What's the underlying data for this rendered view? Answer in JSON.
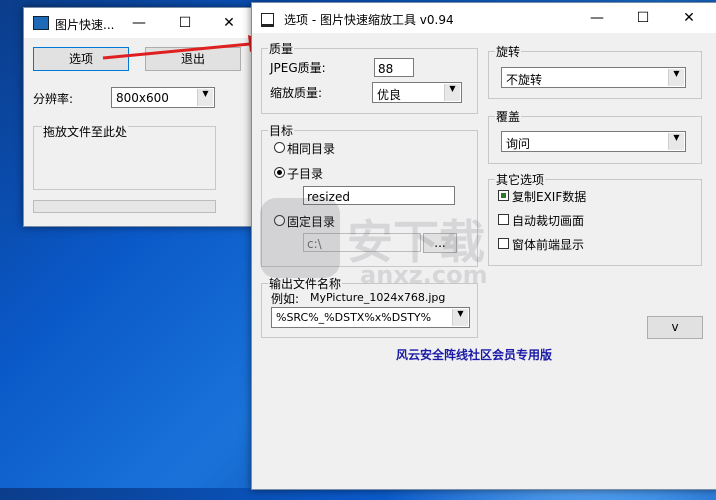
{
  "main_window": {
    "title": "图片快速...",
    "options_label": "选项",
    "exit_label": "退出",
    "resolution_label": "分辨率:",
    "resolution_value": "800x600",
    "drop_label": "拖放文件至此处"
  },
  "options_window": {
    "title": "选项 - 图片快速缩放工具 v0.94",
    "quality": {
      "group_title": "质量",
      "jpeg_label": "JPEG质量:",
      "jpeg_value": "88",
      "scale_label": "缩放质量:",
      "scale_value": "优良"
    },
    "rotate": {
      "group_title": "旋转",
      "value": "不旋转"
    },
    "overwrite": {
      "group_title": "覆盖",
      "value": "询问"
    },
    "target": {
      "group_title": "目标",
      "same_dir": "相同目录",
      "sub_dir": "子目录",
      "sub_dir_value": "resized",
      "fixed_dir": "固定目录",
      "fixed_dir_value": "c:\\",
      "browse_label": "..."
    },
    "other": {
      "group_title": "其它选项",
      "copy_exif": "复制EXIF数据",
      "auto_crop": "自动裁切画面",
      "topmost": "窗体前端显示"
    },
    "output": {
      "group_title": "输出文件名称",
      "example_prefix": "例如:",
      "example_value": "MyPicture_1024x768.jpg",
      "pattern_value": "%SRC%_%DSTX%x%DSTY%"
    },
    "collapse_label": "v",
    "footer": "风云安全阵线社区会员专用版"
  },
  "watermark": {
    "text": "安下载",
    "sub": "anxz.com"
  },
  "colors": {
    "accent": "#0078d7",
    "arrow": "#e02020",
    "footer": "#1a1aa8"
  }
}
